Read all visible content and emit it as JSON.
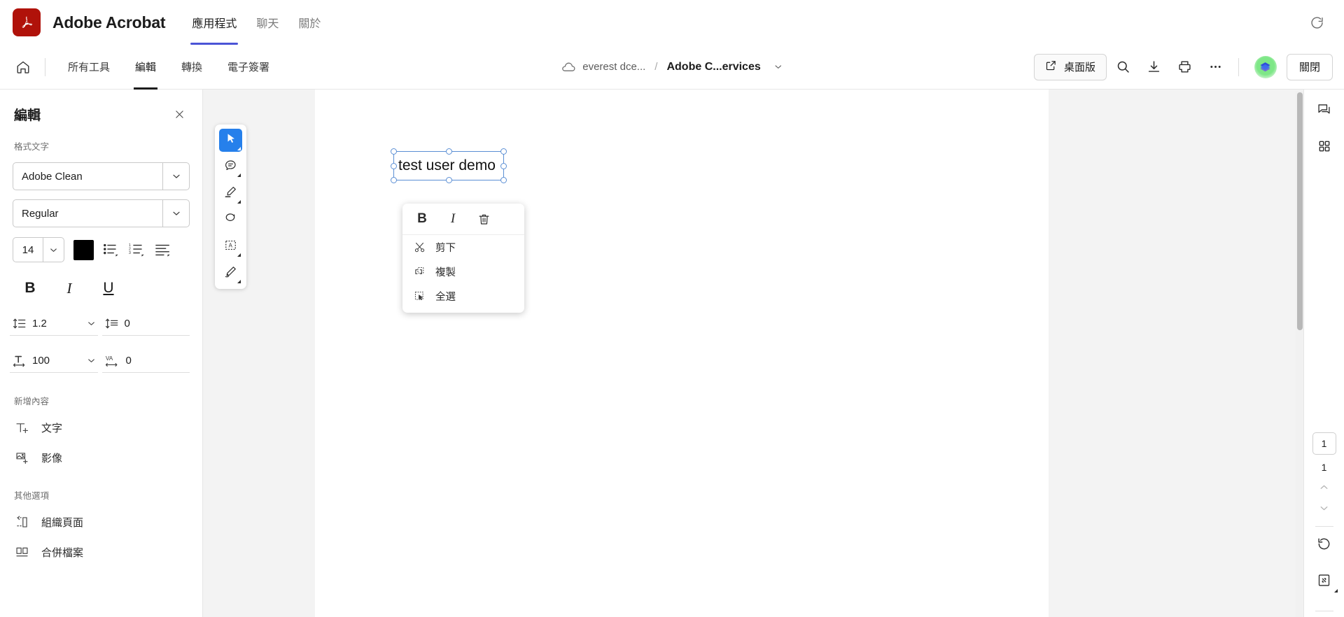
{
  "titlebar": {
    "logo_icon": "adobe-acrobat-logo",
    "app_title": "Adobe Acrobat",
    "tabs": [
      {
        "label": "應用程式",
        "active": true
      },
      {
        "label": "聊天",
        "active": false
      },
      {
        "label": "關於",
        "active": false
      }
    ],
    "refresh_icon": "refresh-icon",
    "accent_color": "#4b54d6",
    "logo_color": "#b0120a"
  },
  "doc_toolbar": {
    "home_icon": "home-icon",
    "tabs": [
      {
        "label": "所有工具",
        "active": false
      },
      {
        "label": "編輯",
        "active": true
      },
      {
        "label": "轉換",
        "active": false
      },
      {
        "label": "電子簽署",
        "active": false
      }
    ],
    "breadcrumb": {
      "cloud_icon": "cloud-icon",
      "folder": "everest dce...",
      "separator": "/",
      "file": "Adobe C...ervices",
      "chevron_icon": "chevron-down-icon"
    },
    "desktop_button": {
      "label": "桌面版",
      "icon": "external-link-icon"
    },
    "search_icon": "search-icon",
    "download_icon": "download-icon",
    "print_icon": "print-icon",
    "more_icon": "more-horizontal-icon",
    "avatar_icon": "user-avatar",
    "close_button": "關閉"
  },
  "left_panel": {
    "title": "編輯",
    "close_icon": "close-icon",
    "format_text_label": "格式文字",
    "font_family": "Adobe Clean",
    "font_style": "Regular",
    "font_size": "14",
    "font_color": "#000000",
    "list_icons": [
      "bulleted-list-icon",
      "numbered-list-icon",
      "text-align-icon"
    ],
    "bold_label": "B",
    "italic_label": "I",
    "underline_label": "U",
    "line_spacing": "1.2",
    "paragraph_spacing": "0",
    "horizontal_scale": "100",
    "tracking": "0",
    "line_spacing_icon": "line-spacing-icon",
    "paragraph_spacing_icon": "paragraph-spacing-icon",
    "horizontal_scale_icon": "horizontal-scale-icon",
    "tracking_icon": "tracking-icon",
    "add_content_label": "新增內容",
    "add_items": [
      {
        "label": "文字",
        "icon": "add-text-icon"
      },
      {
        "label": "影像",
        "icon": "add-image-icon"
      }
    ],
    "other_options_label": "其他選項",
    "other_items": [
      {
        "label": "組織頁面",
        "icon": "organize-pages-icon"
      },
      {
        "label": "合併檔案",
        "icon": "combine-files-icon"
      }
    ]
  },
  "vertical_toolbar": {
    "tools": [
      {
        "name": "select-tool",
        "icon": "cursor-arrow-icon",
        "active": true
      },
      {
        "name": "comment-tool",
        "icon": "comment-bubble-icon",
        "active": false
      },
      {
        "name": "highlight-tool",
        "icon": "highlighter-icon",
        "active": false
      },
      {
        "name": "draw-tool",
        "icon": "lasso-icon",
        "active": false
      },
      {
        "name": "text-select-tool",
        "icon": "text-box-icon",
        "active": false
      },
      {
        "name": "signature-tool",
        "icon": "fountain-pen-icon",
        "active": false
      }
    ],
    "active_color": "#2680eb"
  },
  "document": {
    "text_object": "test user demo",
    "selection_color": "#5b8fd4"
  },
  "context_menu": {
    "bold_label": "B",
    "italic_label": "I",
    "delete_icon": "trash-icon",
    "items": [
      {
        "label": "剪下",
        "icon": "scissors-icon"
      },
      {
        "label": "複製",
        "icon": "copy-icon"
      },
      {
        "label": "全選",
        "icon": "select-all-icon"
      }
    ]
  },
  "right_rail": {
    "comment_icon": "comment-panel-icon",
    "thumbnails_icon": "page-thumbnails-icon",
    "current_page": "1",
    "total_pages": "1",
    "prev_icon": "chevron-up-icon",
    "next_icon": "chevron-down-icon",
    "rotate_icon": "rotate-icon",
    "fit_page_icon": "fit-page-icon"
  }
}
